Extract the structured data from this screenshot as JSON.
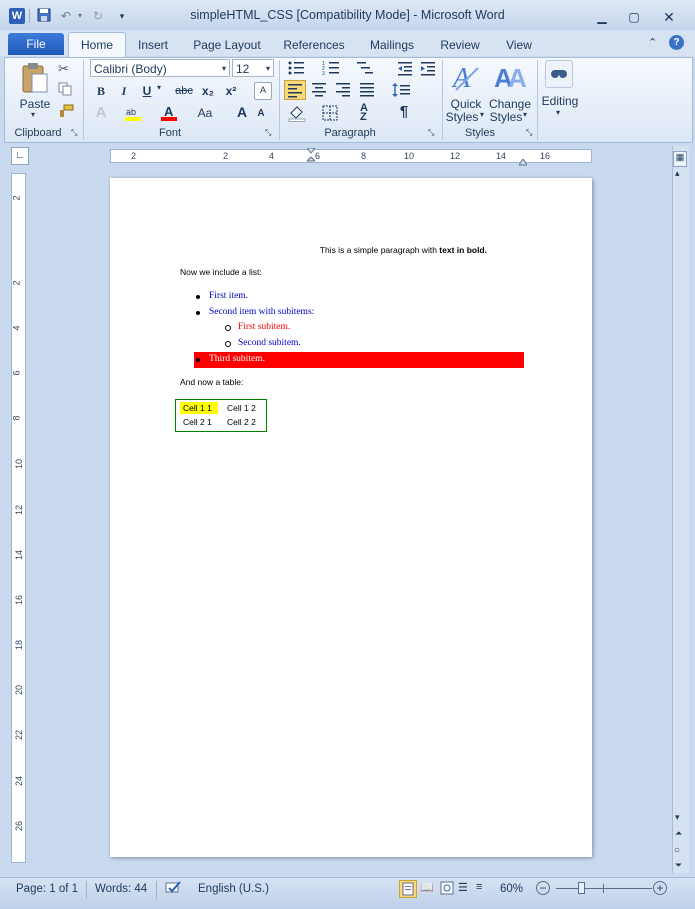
{
  "window": {
    "title": "simpleHTML_CSS [Compatibility Mode]  -  Microsoft Word",
    "app_icon": "word-logo",
    "controls": [
      "minimize",
      "restore",
      "close"
    ]
  },
  "tabs": [
    {
      "label": "File"
    },
    {
      "label": "Home"
    },
    {
      "label": "Insert"
    },
    {
      "label": "Page Layout"
    },
    {
      "label": "References"
    },
    {
      "label": "Mailings"
    },
    {
      "label": "Review"
    },
    {
      "label": "View"
    }
  ],
  "ribbon": {
    "clipboard": {
      "group": "Clipboard",
      "paste": "Paste"
    },
    "font": {
      "group": "Font",
      "font_name": "Calibri (Body)",
      "font_size": "12",
      "bold": "B",
      "italic": "I",
      "underline": "U",
      "strike": "abc",
      "subscript": "x₂",
      "superscript": "x²",
      "grow": "A",
      "shrink": "A",
      "change_case": "Aa"
    },
    "paragraph": {
      "group": "Paragraph",
      "pilcrow": "¶"
    },
    "styles": {
      "group": "Styles",
      "quick_styles": "Quick",
      "quick_styles2": "Styles",
      "change_styles": "Change",
      "change_styles2": "Styles"
    },
    "editing": {
      "label": "Editing"
    }
  },
  "ruler": {
    "h_numbers": [
      "2",
      "2",
      "4",
      "6",
      "8",
      "10",
      "12",
      "14",
      "16"
    ],
    "v_numbers": [
      "2",
      "2",
      "4",
      "6",
      "8",
      "10",
      "12",
      "14",
      "16",
      "18",
      "20",
      "22",
      "24",
      "26"
    ]
  },
  "document": {
    "para1_normal": "This is a simple paragraph with ",
    "para1_bold": "text in bold.",
    "list_intro": "Now we include a list:",
    "items": [
      "First item.",
      "Second item with subitems:",
      "Third subitem."
    ],
    "subitems": [
      "First subitem.",
      "Second subitem."
    ],
    "table_intro": "And now a table:",
    "table": [
      [
        "Cell 1 1",
        "Cell 1 2"
      ],
      [
        "Cell 2 1",
        "Cell 2 2"
      ]
    ],
    "colors": {
      "blue": "#0000cc",
      "red": "#ff0000",
      "yellow": "#ffff00",
      "table_border": "#008000"
    }
  },
  "status": {
    "page": "Page: 1 of 1",
    "words": "Words: 44",
    "language": "English (U.S.)",
    "zoom": "60%"
  }
}
